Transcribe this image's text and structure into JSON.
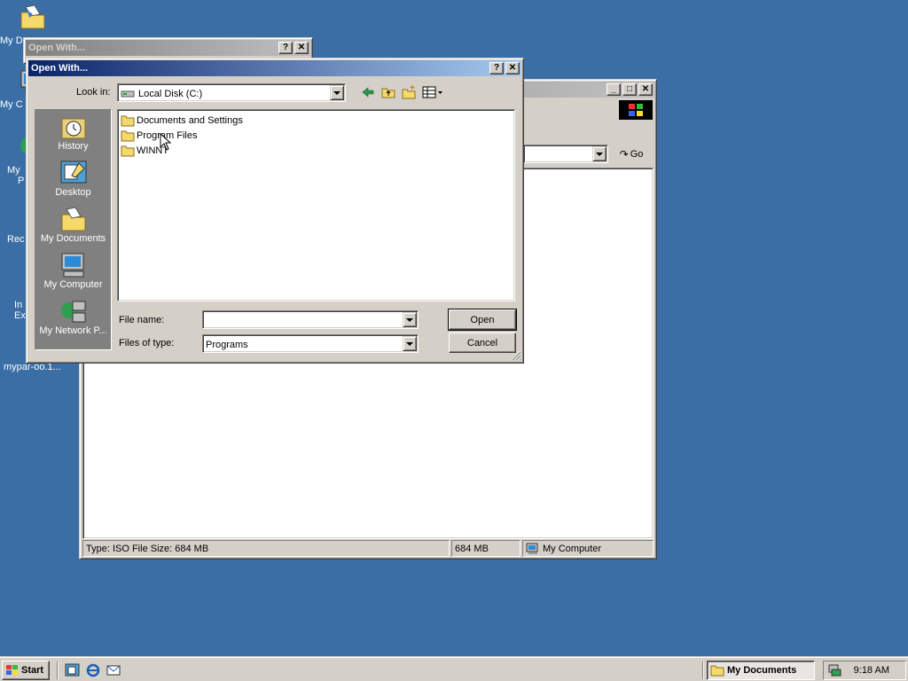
{
  "desktop": {
    "icons": [
      {
        "label": "My D",
        "icon": "my-documents-icon"
      },
      {
        "label": "My C",
        "icon": "my-computer-icon"
      },
      {
        "label": "My",
        "label2": "P",
        "icon": "my-network-places-icon"
      },
      {
        "label": "Rec",
        "icon": "recycle-bin-icon"
      },
      {
        "label": "In",
        "label2": "Ex",
        "icon": "internet-explorer-icon"
      },
      {
        "label": "mypar-oo.1...",
        "icon": "iso-file-icon"
      }
    ]
  },
  "back_dialog": {
    "title": "Open With..."
  },
  "explorer": {
    "go_label": "Go",
    "status": {
      "info": "Type: ISO File Size: 684 MB",
      "size": "684 MB",
      "zone": "My Computer"
    }
  },
  "dialog": {
    "title": "Open With...",
    "look_in_label": "Look in:",
    "look_in_value": "Local Disk (C:)",
    "places": [
      {
        "label": "History",
        "icon": "history-icon"
      },
      {
        "label": "Desktop",
        "icon": "desktop-icon"
      },
      {
        "label": "My Documents",
        "icon": "my-documents-icon"
      },
      {
        "label": "My Computer",
        "icon": "my-computer-icon"
      },
      {
        "label": "My Network P...",
        "icon": "my-network-places-icon"
      }
    ],
    "files": [
      {
        "name": "Documents and Settings"
      },
      {
        "name": "Program Files"
      },
      {
        "name": "WINNT"
      }
    ],
    "file_name_label": "File name:",
    "file_name_value": "",
    "files_of_type_label": "Files of type:",
    "files_of_type_value": "Programs",
    "open_label": "Open",
    "cancel_label": "Cancel"
  },
  "taskbar": {
    "start_label": "Start",
    "task_label": "My Documents",
    "clock": "9:18 AM"
  },
  "colors": {
    "desktop": "#3a6ea5",
    "title_active_start": "#0a246a",
    "title_active_end": "#a6caf0",
    "face": "#d4d0c8"
  }
}
